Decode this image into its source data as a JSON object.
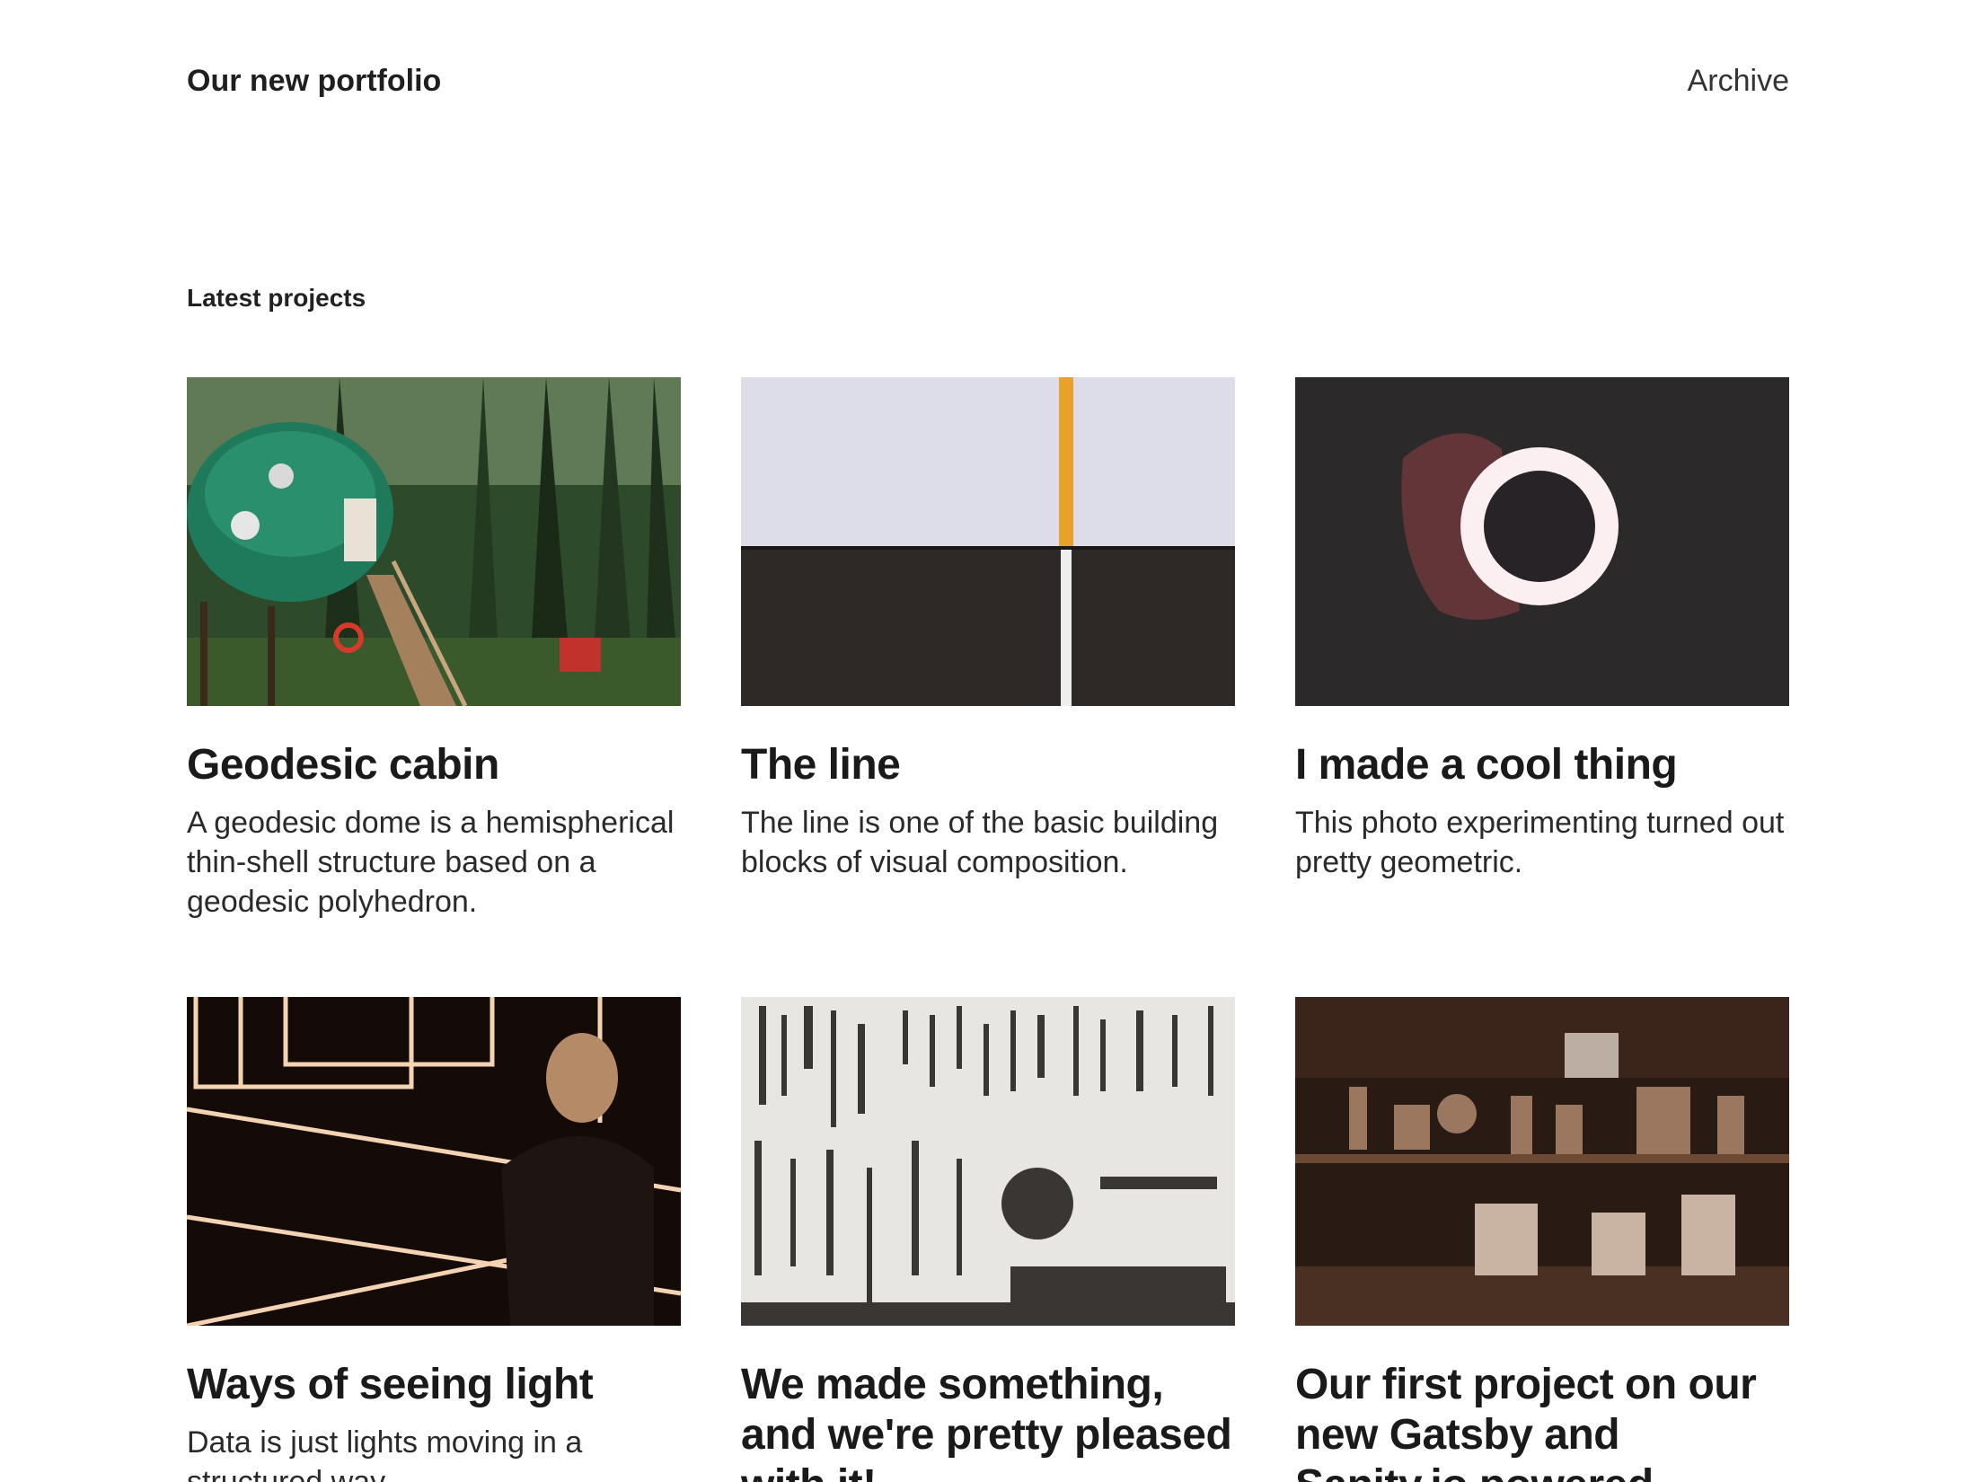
{
  "header": {
    "site_title": "Our new portfolio",
    "nav": [
      {
        "label": "Archive"
      }
    ]
  },
  "section": {
    "heading": "Latest projects"
  },
  "projects": [
    {
      "title": "Geodesic cabin",
      "excerpt": "A geodesic dome is a hemispherical thin-shell structure based on a geodesic polyhedron.",
      "image": "geodesic-dome-cabin-in-forest"
    },
    {
      "title": "The line",
      "excerpt": "The line is one of the basic building blocks of visual composition.",
      "image": "yellow-line-on-wall-and-asphalt"
    },
    {
      "title": "I made a cool thing",
      "excerpt": "This photo experimenting turned out pretty geometric.",
      "image": "glowing-ring-light-in-hand"
    },
    {
      "title": "Ways of seeing light",
      "excerpt": "Data is just lights moving in a structured way.",
      "image": "person-in-neon-light-room"
    },
    {
      "title": "We made something, and we're pretty pleased with it!",
      "excerpt": "",
      "image": "tool-wall"
    },
    {
      "title": "Our first project on our new Gatsby and Sanity.io powered",
      "excerpt": "",
      "image": "vintage-shop-shelves"
    }
  ]
}
